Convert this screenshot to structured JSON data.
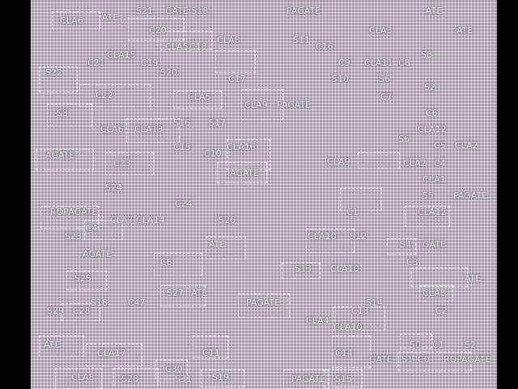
{
  "labels": [
    "CLA6",
    "ATE",
    "S21",
    "GATE S18",
    "PAGATE",
    "ATE",
    "C20",
    "CLA3",
    "ATE",
    "CLA8",
    "S11",
    "CLA5",
    "C18",
    "C16",
    "S8",
    "CLA15",
    "C21",
    "C19",
    "C9",
    "CLA11",
    "C8",
    "S22",
    "S20",
    "C17",
    "S10",
    "S6",
    "S2",
    "C22",
    "CLA5",
    "C7",
    "CLA9",
    "PAGATE",
    "S3",
    "C6",
    "S16",
    "S17",
    "CLA6",
    "CLA13",
    "CLA12",
    "S6",
    "C5",
    "CLA2",
    "C15",
    "C10",
    "CLA16",
    "AGATE",
    "C23",
    "CLA9",
    "CLA2",
    "C4",
    "AGATE",
    "CLA1",
    "S24",
    "S5",
    "PAGATE",
    "C24",
    "ROPAGATE",
    "C1",
    "CLA12",
    "CLA7",
    "CLA14",
    "S26",
    "C4",
    "S23",
    "CLA10",
    "S12",
    "S4",
    "GATE",
    "ATE",
    "AGATE",
    "C3",
    "C6",
    "S13",
    "CLA10",
    "S25",
    "ATE",
    "S18",
    "C47",
    "S27",
    "ATE",
    "CLA8",
    "PAGATE",
    "S14",
    "C2",
    "S29",
    "C28",
    "C13",
    "CLA4",
    "CLA10",
    "ATE",
    "CLA17",
    "C11",
    "S0",
    "C1",
    "S2",
    "C14",
    "GATE",
    "S1",
    "C0",
    "ROPAGATE",
    "CLA8",
    "S28",
    "C30",
    "S31",
    "S19",
    "PAGATE",
    "S15"
  ]
}
